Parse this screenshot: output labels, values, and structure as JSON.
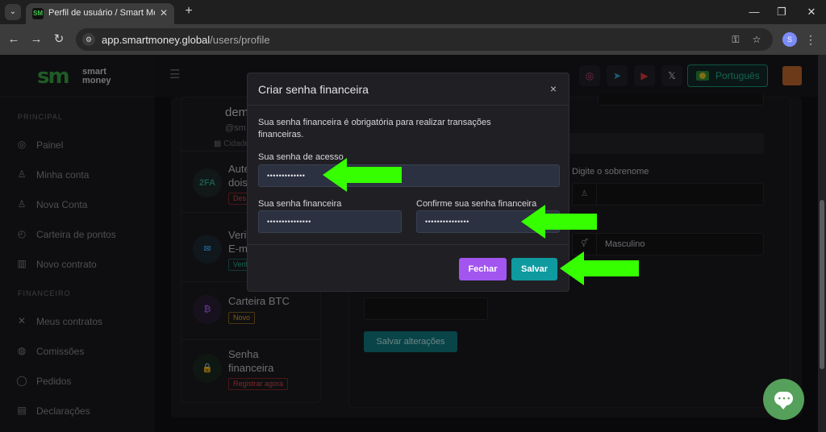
{
  "browser": {
    "tab_title": "Perfil de usuário / Smart Money",
    "tab_favicon_text": "SM",
    "new_tab_symbol": "+",
    "url_host": "app.smartmoney.global",
    "url_path": "/users/profile",
    "profile_initial": "S",
    "controls": {
      "minimize": "—",
      "restore": "❐",
      "close": "✕",
      "back": "←",
      "forward": "→",
      "reload": "↻",
      "tab_menu": "⌄",
      "tab_close": "✕",
      "site_info": "⚙",
      "key": "⚿",
      "bookmark": "☆",
      "menu": "⋮"
    }
  },
  "sidebar": {
    "logo_mark": "sm",
    "logo_text_1": "smart",
    "logo_text_2": "money",
    "section_principal": "PRINCIPAL",
    "section_financeiro": "FINANCEIRO",
    "items": [
      {
        "label": "Painel",
        "icon": "◎"
      },
      {
        "label": "Minha conta",
        "icon": "♙"
      },
      {
        "label": "Nova Conta",
        "icon": "♙"
      },
      {
        "label": "Carteira de pontos",
        "icon": "◴"
      },
      {
        "label": "Novo contrato",
        "icon": "▥"
      },
      {
        "label": "Meus contratos",
        "icon": "✕"
      },
      {
        "label": "Comissões",
        "icon": "◍"
      },
      {
        "label": "Pedidos",
        "icon": "◯"
      },
      {
        "label": "Declarações",
        "icon": "▤"
      }
    ]
  },
  "topbar": {
    "hamburger": "☰",
    "social_instagram": "◎",
    "social_telegram": "➤",
    "social_youtube": "▶",
    "social_x": "𝕏",
    "language": "Português"
  },
  "profile_card": {
    "name": "dem",
    "handle": "@sm",
    "city": "Cidade",
    "city_icon": "▦",
    "security": [
      {
        "icon": "2FA",
        "title_1": "Aute",
        "title_2": "dois",
        "badge": "Des"
      },
      {
        "icon": "✉",
        "title_1": "Verif",
        "title_2": "E-m",
        "badge": "Verif"
      },
      {
        "icon": "₿",
        "title_1": "Carteira BTC",
        "title_2": "",
        "badge": "Novo"
      },
      {
        "icon": "🔒",
        "title_1": "Senha",
        "title_2": "financeira",
        "badge": "Registrar agora"
      }
    ]
  },
  "form": {
    "sobrenome_label": "Digite o sobrenome",
    "user_icon": "♙",
    "gender_icon": "⚥",
    "gender_value": "Masculino",
    "save_changes": "Salvar alterações"
  },
  "modal": {
    "title": "Criar senha financeira",
    "close": "×",
    "description": "Sua senha financeira é obrigatória para realizar transações financeiras.",
    "access_label": "Sua senha de acesso",
    "access_value": "•••••••••••••",
    "financial_label": "Sua senha financeira",
    "financial_value": "•••••••••••••••",
    "confirm_label": "Confirme sua senha financeira",
    "confirm_value": "•••••••••••••••",
    "btn_close": "Fechar",
    "btn_save": "Salvar"
  },
  "colors": {
    "accent_green": "#33ff00",
    "teal": "#0f9aa0",
    "purple": "#a355f0"
  }
}
